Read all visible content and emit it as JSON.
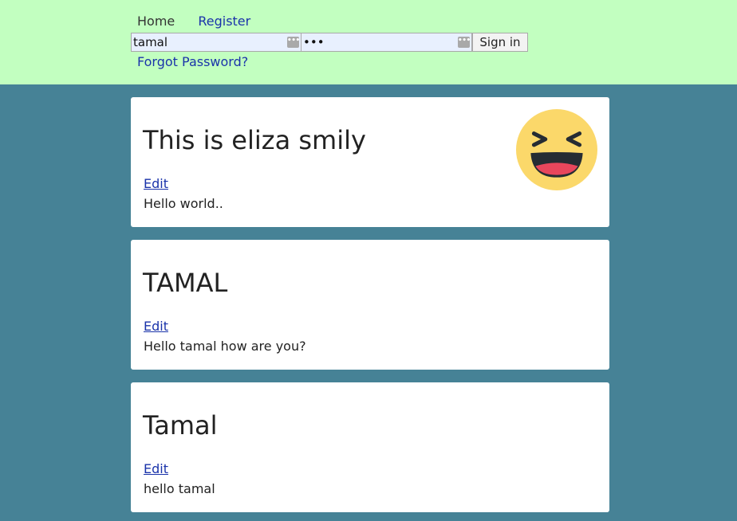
{
  "nav": {
    "home_label": "Home",
    "register_label": "Register"
  },
  "login": {
    "username_value": "tamal",
    "password_value": "•••",
    "signin_label": "Sign in",
    "forgot_label": "Forgot Password?"
  },
  "posts": [
    {
      "title": "This is eliza smily",
      "edit_label": "Edit",
      "body": "Hello world..",
      "emoji": "laughing-emoji-icon"
    },
    {
      "title": "TAMAL",
      "edit_label": "Edit",
      "body": "Hello tamal how are you?"
    },
    {
      "title": "Tamal",
      "edit_label": "Edit",
      "body": "hello tamal"
    }
  ],
  "colors": {
    "header_bg": "#c2ffc0",
    "page_bg": "#468296",
    "link": "#1a33aa",
    "card_bg": "#ffffff",
    "emoji_face": "#fbd86a",
    "emoji_mouth": "#e8465c"
  }
}
